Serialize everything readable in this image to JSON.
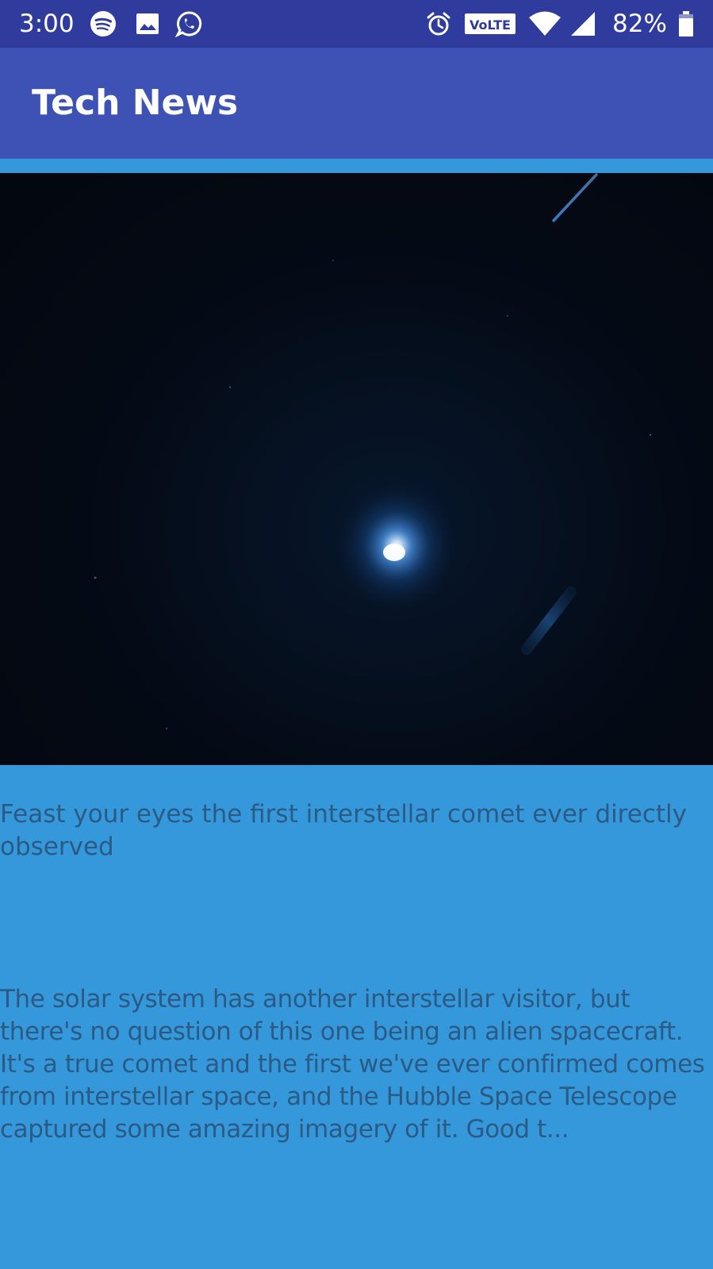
{
  "status_bar": {
    "time": "3:00",
    "left_icons": [
      "spotify-icon",
      "gallery-icon",
      "whatsapp-icon"
    ],
    "right_icons": [
      "alarm-icon",
      "volte-icon",
      "wifi-icon",
      "cell-signal-icon",
      "battery-icon"
    ],
    "volte_label": "VoLTE",
    "battery_percent": "82%",
    "battery_level": 0.82
  },
  "app_bar": {
    "title": "Tech News"
  },
  "article": {
    "image_icon": "comet-photo",
    "headline": "Feast your eyes the first interstellar comet ever directly observed",
    "summary": "The solar system has another interstellar visitor, but there's no question of this one being an alien spacecraft. It's a true comet and the first we've ever confirmed comes from interstellar space, and the Hubble Space Telescope captured some amazing imagery of it. Good t..."
  },
  "colors": {
    "status_bar": "#2F3C9E",
    "app_bar": "#3E51B5",
    "card_background": "#3598DB",
    "text": "#2B5A84"
  }
}
